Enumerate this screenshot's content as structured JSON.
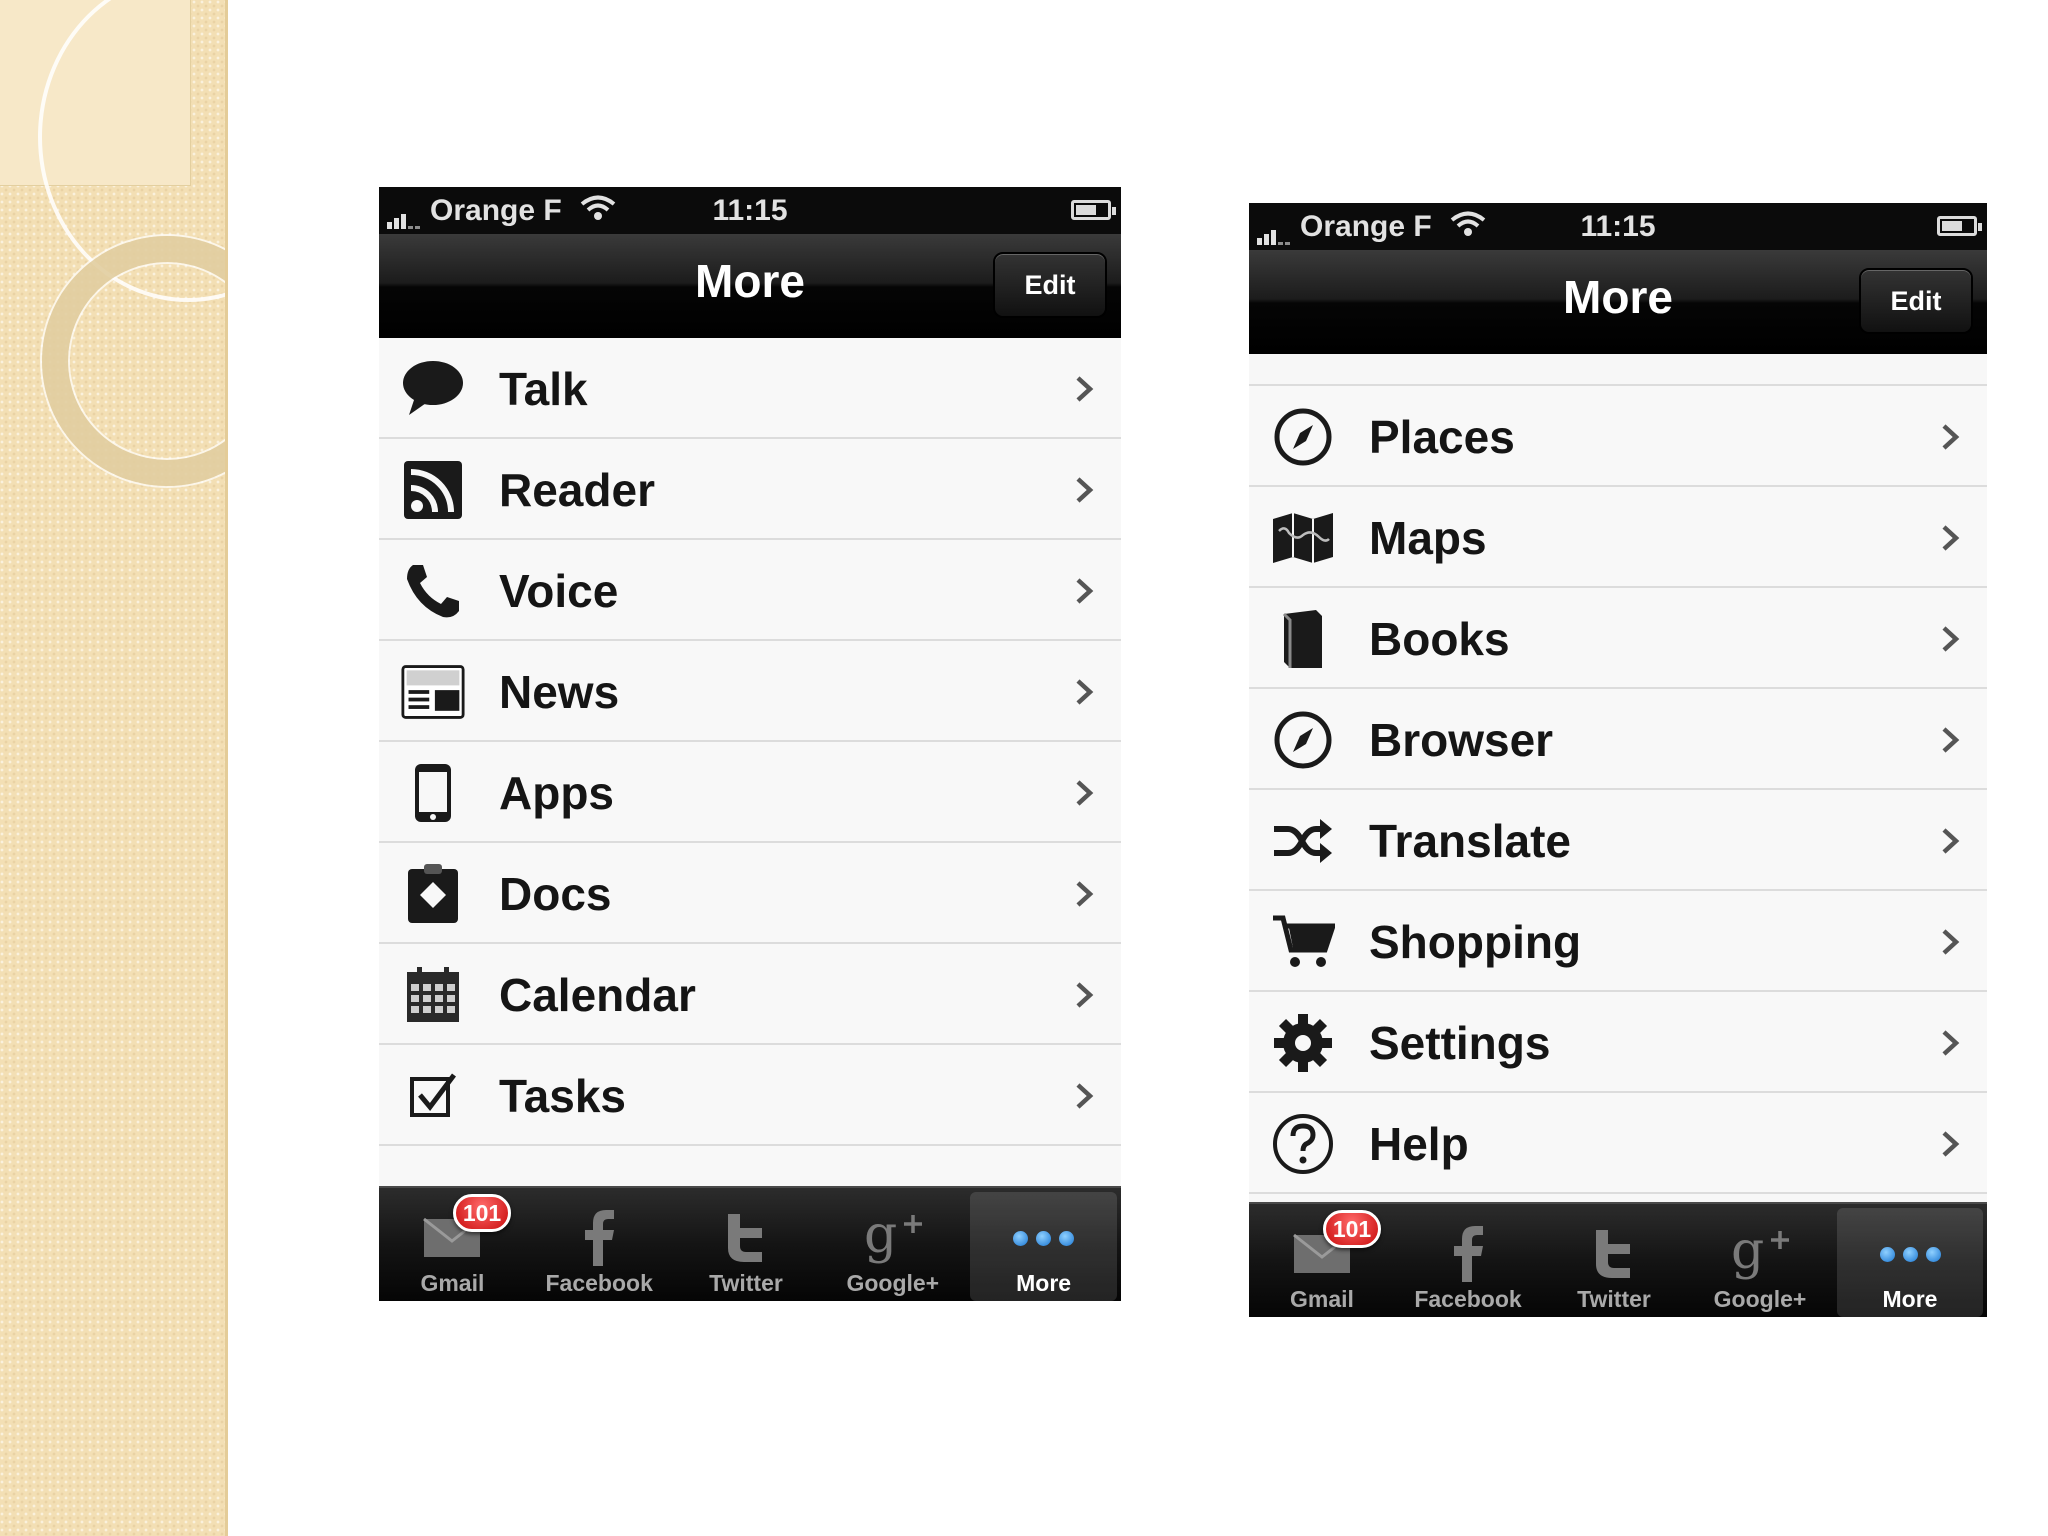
{
  "status_bar": {
    "carrier": "Orange F",
    "time": "11:15"
  },
  "nav": {
    "title": "More",
    "edit_label": "Edit"
  },
  "left_screen": {
    "items": [
      {
        "label": "Talk",
        "icon": "speech-bubble-icon"
      },
      {
        "label": "Reader",
        "icon": "rss-icon"
      },
      {
        "label": "Voice",
        "icon": "phone-icon"
      },
      {
        "label": "News",
        "icon": "newspaper-icon"
      },
      {
        "label": "Apps",
        "icon": "mobile-phone-icon"
      },
      {
        "label": "Docs",
        "icon": "clipboard-icon"
      },
      {
        "label": "Calendar",
        "icon": "calendar-icon"
      },
      {
        "label": "Tasks",
        "icon": "checkbox-icon"
      }
    ]
  },
  "right_screen": {
    "items": [
      {
        "label": "Places",
        "icon": "compass-icon"
      },
      {
        "label": "Maps",
        "icon": "map-icon"
      },
      {
        "label": "Books",
        "icon": "book-icon"
      },
      {
        "label": "Browser",
        "icon": "compass-icon"
      },
      {
        "label": "Translate",
        "icon": "shuffle-icon"
      },
      {
        "label": "Shopping",
        "icon": "cart-icon"
      },
      {
        "label": "Settings",
        "icon": "gear-icon"
      },
      {
        "label": "Help",
        "icon": "help-icon"
      }
    ]
  },
  "tabs": [
    {
      "label": "Gmail",
      "icon": "envelope-icon",
      "badge": "101"
    },
    {
      "label": "Facebook",
      "icon": "facebook-icon"
    },
    {
      "label": "Twitter",
      "icon": "twitter-icon"
    },
    {
      "label": "Google+",
      "icon": "google-plus-icon"
    },
    {
      "label": "More",
      "icon": "more-dots-icon",
      "active": true
    }
  ],
  "colors": {
    "accent_blue": "#1a76d2",
    "badge_red": "#c90c0c",
    "bar_black": "#0b0b0b",
    "strip_beige": "#f3dfb4"
  }
}
